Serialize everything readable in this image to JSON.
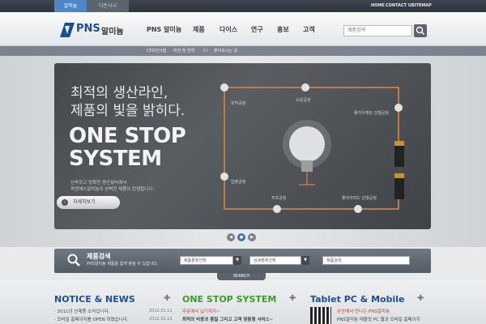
{
  "topbar": {
    "tab_active": "알미늄",
    "tab_other": "디존사시",
    "links": [
      "HOME",
      "CONTACT US",
      "SITEMAP"
    ]
  },
  "header": {
    "logo_brand": "PNS",
    "logo_name": "알미늄",
    "nav": [
      "PNS 알미늄",
      "제품",
      "다이스",
      "연구",
      "홍보",
      "고객"
    ],
    "search_placeholder": "제품검색"
  },
  "subnav": [
    "CEO인사말",
    "비전 및 연혁",
    "CI",
    "찾아오시는 길"
  ],
  "hero": {
    "headline1": "최적의 생산라인,",
    "headline2": "제품의 빛을 밝히다.",
    "big1": "ONE STOP",
    "big2": "SYSTEM",
    "desc1": "신속하고 정확한 생산설비에서",
    "desc2": "피엔에스알미늄의 완벽한 제품이 탄생합니다.",
    "button": "자세히보기",
    "process": [
      "피막공정",
      "도장공정",
      "폴리우레탄 단열공정",
      "압출공정",
      "주조공정",
      "폴리아미드 단열공정"
    ]
  },
  "pager": [
    "◀",
    "●",
    "▶"
  ],
  "product_search": {
    "title": "제품검색",
    "desc": "PNS알미늄 제품을 쉽게 찾을 수 있습니다.",
    "select1": "제품분류선택",
    "select2": "상세분류선택",
    "input": "제품검색",
    "tab": "SEARCH"
  },
  "notice": {
    "title": "NOTICE & NEWS",
    "items": [
      {
        "text": "2011년 신제품 소식입니다.",
        "date": "2012.01.11"
      },
      {
        "text": "모바일 홈페이지를 OPEN 하였습니다.",
        "date": "2012.01.15"
      }
    ]
  },
  "onestop": {
    "title": "ONE STOP SYSTEM",
    "line1": "주문에서 납기까지~",
    "line2": "최적의 비용과 품질 그리고 고객 맞춤형 서비스~"
  },
  "tablet": {
    "title": "Tablet PC & Mobile",
    "line1": "손안에서 만나는 PNS알미늄",
    "line2": "PNS알미늄 태블릿 PC 웹과 모바일 홈페이지"
  },
  "colors": {
    "accent_blue": "#1f4f93",
    "accent_green": "#3f9a2c",
    "tab_blue": "#4f86c6"
  }
}
